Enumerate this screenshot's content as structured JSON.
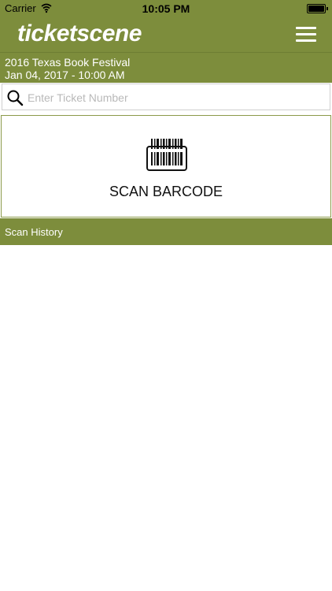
{
  "status_bar": {
    "carrier": "Carrier",
    "time": "10:05 PM"
  },
  "header": {
    "logo_text": "ticketscene",
    "brand_color": "#7d8d3c"
  },
  "event": {
    "name": "2016 Texas Book Festival",
    "datetime": "Jan 04, 2017 - 10:00 AM"
  },
  "search": {
    "placeholder": "Enter Ticket Number",
    "value": ""
  },
  "scan": {
    "label": "SCAN BARCODE"
  },
  "history": {
    "label": "Scan History"
  },
  "icons": {
    "wifi": "wifi-icon",
    "battery": "battery-icon",
    "menu": "hamburger-menu-icon",
    "search": "search-icon",
    "barcode": "barcode-scanner-icon"
  }
}
